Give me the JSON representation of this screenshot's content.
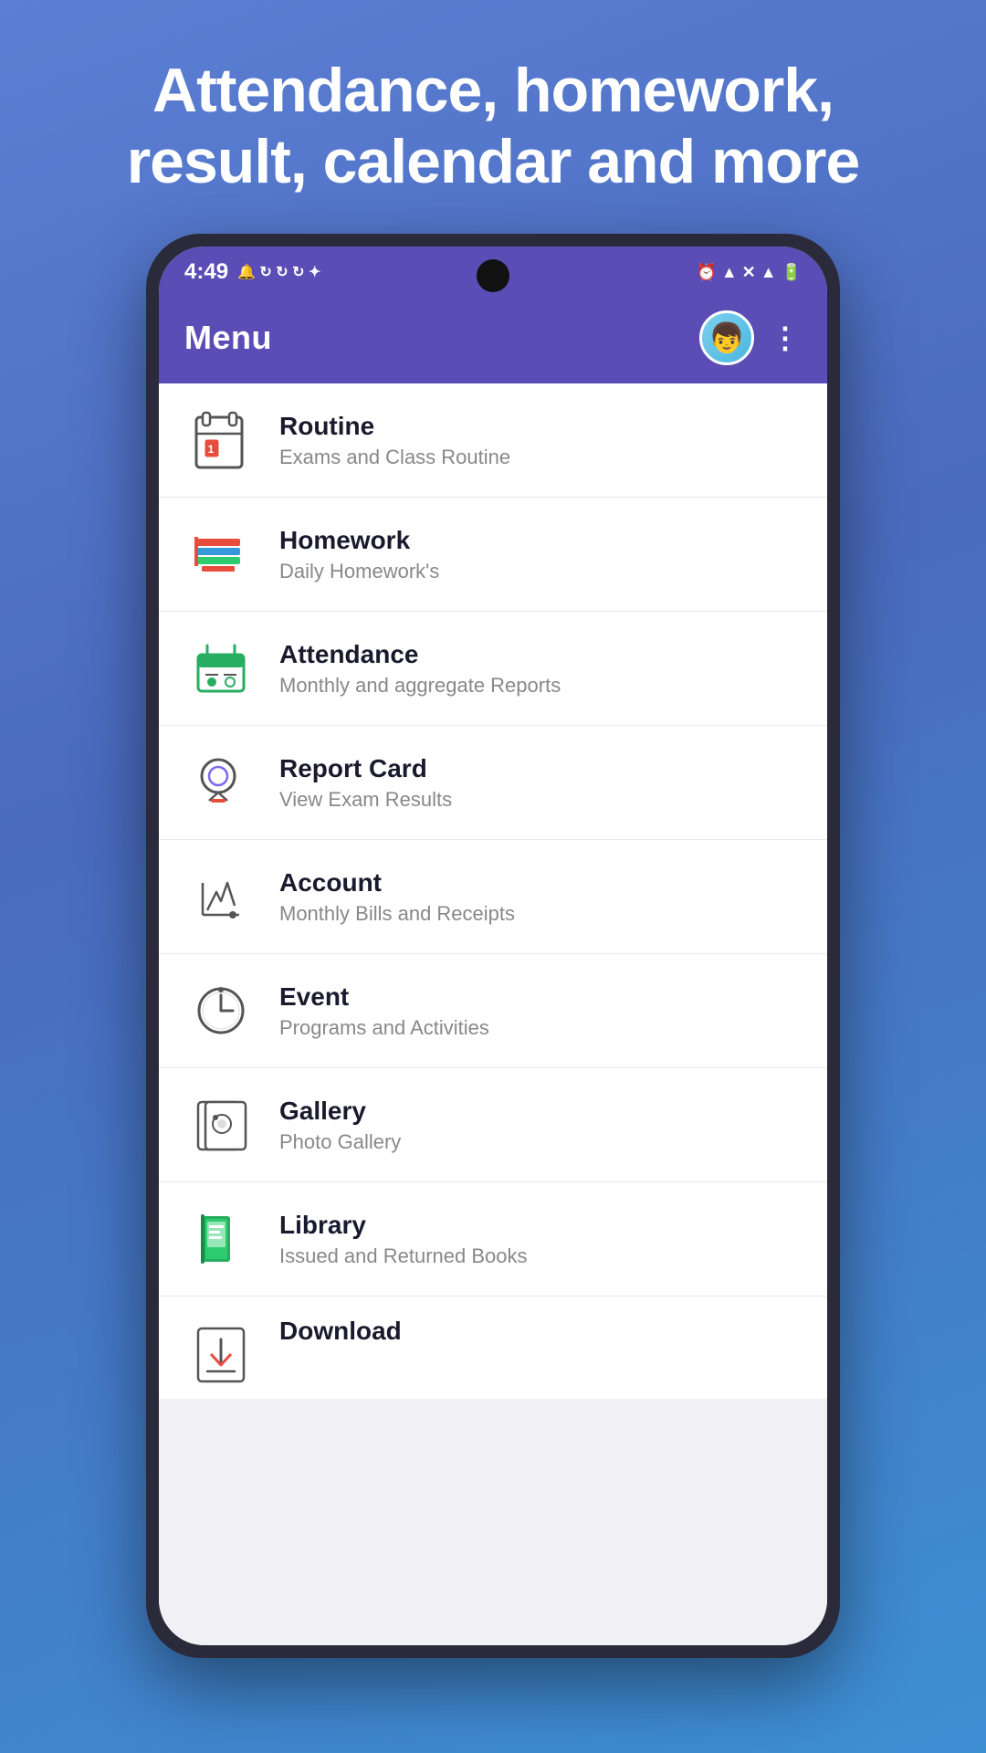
{
  "hero": {
    "text": "Attendance, homework, result, calendar and more"
  },
  "statusBar": {
    "time": "4:49",
    "rightIcons": "⏰ ▲ ✕ ▲ 🔋"
  },
  "appBar": {
    "title": "Menu",
    "moreIcon": "⋮"
  },
  "menuItems": [
    {
      "id": "routine",
      "title": "Routine",
      "subtitle": "Exams and Class Routine",
      "iconColor": "#e74c3c"
    },
    {
      "id": "homework",
      "title": "Homework",
      "subtitle": "Daily Homework's",
      "iconColor": "#e74c3c"
    },
    {
      "id": "attendance",
      "title": "Attendance",
      "subtitle": "Monthly and aggregate Reports",
      "iconColor": "#27ae60"
    },
    {
      "id": "report-card",
      "title": "Report Card",
      "subtitle": "View Exam Results",
      "iconColor": "#8e44ad"
    },
    {
      "id": "account",
      "title": "Account",
      "subtitle": "Monthly Bills and Receipts",
      "iconColor": "#555"
    },
    {
      "id": "event",
      "title": "Event",
      "subtitle": "Programs and Activities",
      "iconColor": "#555"
    },
    {
      "id": "gallery",
      "title": "Gallery",
      "subtitle": "Photo Gallery",
      "iconColor": "#555"
    },
    {
      "id": "library",
      "title": "Library",
      "subtitle": "Issued and Returned Books",
      "iconColor": "#27ae60"
    },
    {
      "id": "download",
      "title": "Download",
      "subtitle": "",
      "iconColor": "#e74c3c"
    }
  ]
}
